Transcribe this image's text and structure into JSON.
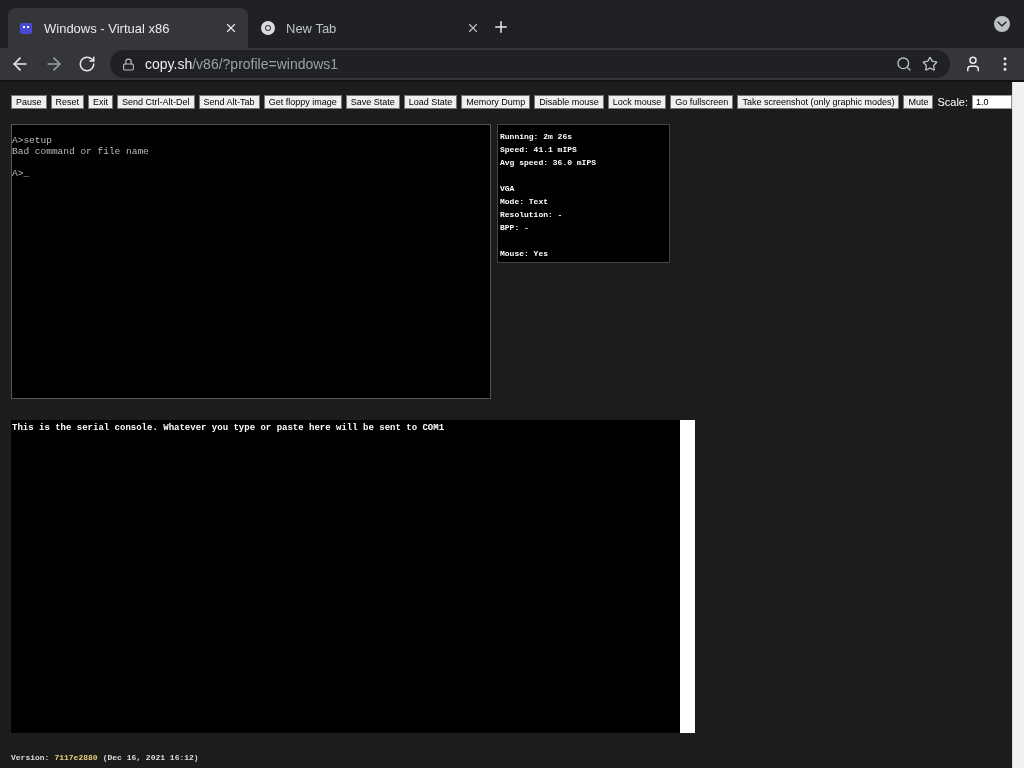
{
  "browser": {
    "tabs": [
      {
        "title": "Windows - Virtual x86",
        "selected": true
      },
      {
        "title": "New Tab",
        "selected": false
      }
    ],
    "url": {
      "host": "copy.sh",
      "path": "/v86/?profile=windows1"
    }
  },
  "toolbar": {
    "buttons": [
      "Pause",
      "Reset",
      "Exit",
      "Send Ctrl-Alt-Del",
      "Send Alt-Tab",
      "Get floppy image",
      "Save State",
      "Load State",
      "Memory Dump",
      "Disable mouse",
      "Lock mouse",
      "Go fullscreen",
      "Take screenshot (only graphic modes)",
      "Mute"
    ],
    "scale": {
      "label": "Scale:",
      "value": "1.0"
    }
  },
  "screen": {
    "blocks": [
      [
        "A>setup",
        "Bad command or file name"
      ],
      [
        "A>_"
      ]
    ]
  },
  "info": {
    "groups": [
      [
        "Running: 2m 26s",
        "Speed: 41.1 mIPS",
        "Avg speed: 36.0 mIPS"
      ],
      [
        "VGA",
        "Mode: Text",
        "Resolution: -",
        "BPP: -"
      ],
      [
        "Mouse: Yes"
      ]
    ]
  },
  "serial": {
    "text": "This is the serial console. Whatever you type or paste here will be sent to COM1"
  },
  "version": {
    "label": "Version:",
    "hash": "7117e2880",
    "date": "(Dec 16, 2021 16:12)"
  }
}
